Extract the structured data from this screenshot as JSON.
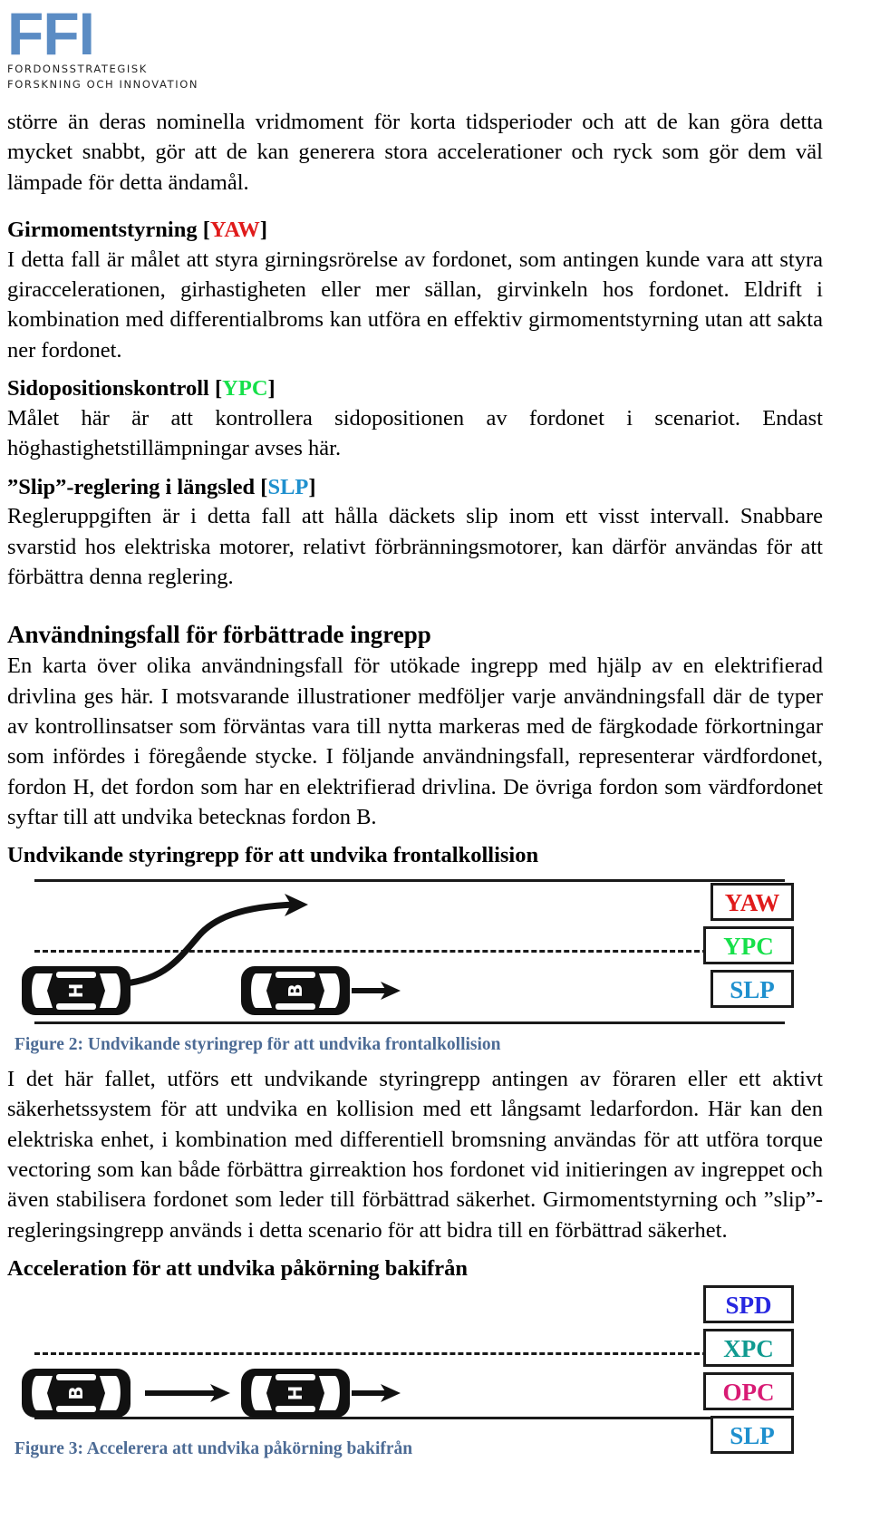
{
  "logo": {
    "mark": "FFI",
    "line1": "FORDONSSTRATEGISK",
    "line2": "FORSKNING OCH INNOVATION",
    "color": "#5b8cc4"
  },
  "paragraphs": {
    "intro": "större än deras nominella vridmoment för korta tidsperioder och att de kan göra detta mycket snabbt, gör att de kan generera stora accelerationer och ryck som gör dem väl lämpade för detta ändamål.",
    "yaw_body": "I detta fall är målet att styra girningsrörelse av fordonet, som antingen kunde vara att styra giraccelerationen, girhastigheten eller mer sällan, girvinkeln hos fordonet. Eldrift i kombination med differentialbroms kan utföra en effektiv girmomentstyrning utan att sakta ner fordonet.",
    "ypc_body": "Målet här är att kontrollera sidopositionen av fordonet i scenariot. Endast höghastighetstillämpningar avses här.",
    "slp_body": "Regleruppgiften är i detta fall att hålla däckets slip inom ett visst intervall. Snabbare svarstid hos elektriska motorer, relativt förbränningsmotorer, kan därför användas för att förbättra denna reglering.",
    "usecase_body": "En karta över olika användningsfall för utökade ingrepp med hjälp av en elektrifierad drivlina ges här. I motsvarande illustrationer medföljer varje användningsfall där de typer av kontrollinsatser som förväntas vara till nytta markeras med de färgkodade förkortningar som infördes i föregående stycke. I följande användningsfall, representerar värdfordonet, fordon H, det fordon som har en elektrifierad drivlina. De övriga fordon som värdfordonet syftar till att undvika betecknas fordon B.",
    "fig2_body": "I det här fallet, utförs ett undvikande styringrepp antingen av föraren eller ett aktivt säkerhetssystem för att undvika en kollision med ett långsamt ledarfordon. Här kan den elektriska enhet, i kombination med differentiell bromsning användas för att utföra torque vectoring som kan både förbättra girreaktion hos fordonet vid initieringen av ingreppet och även stabilisera fordonet som leder till förbättrad säkerhet. Girmomentstyrning och ”slip”-regleringsingrepp används i detta scenario för att bidra till en förbättrad säkerhet."
  },
  "headings": {
    "yaw_title": "Girmomentstyrning",
    "yaw_tag": "YAW",
    "ypc_title": "Sidopositionskontroll",
    "ypc_tag": "YPC",
    "slp_title": "”Slip”-reglering i längsled",
    "slp_tag": "SLP",
    "usecase_title": "Användningsfall för förbättrade ingrepp",
    "fig2_title": "Undvikande styringrepp för att undvika frontalkollision",
    "fig3_title": "Acceleration för att undvika påkörning bakifrån"
  },
  "brackets": {
    "open": "[",
    "close": "]"
  },
  "figure2": {
    "caption": "Figure 2: Undvikande styringrep för att undvika frontalkollision",
    "caption_color": "#4c6b95",
    "badges": [
      {
        "label": "YAW",
        "color": "#e01b1b"
      },
      {
        "label": "YPC",
        "color": "#16e04a"
      },
      {
        "label": "SLP",
        "color": "#1f90ce"
      }
    ],
    "cars": [
      {
        "label": "H",
        "role": "host-vehicle"
      },
      {
        "label": "B",
        "role": "other-vehicle"
      }
    ]
  },
  "figure3": {
    "caption": "Figure 3: Accelerera att undvika påkörning bakifrån",
    "caption_color": "#4c6b95",
    "badges": [
      {
        "label": "SPD",
        "color": "#2727e0"
      },
      {
        "label": "XPC",
        "color": "#109a90"
      },
      {
        "label": "OPC",
        "color": "#d81b74"
      },
      {
        "label": "SLP",
        "color": "#1f90ce"
      }
    ],
    "cars": [
      {
        "label": "B",
        "role": "other-vehicle"
      },
      {
        "label": "H",
        "role": "host-vehicle"
      }
    ]
  }
}
